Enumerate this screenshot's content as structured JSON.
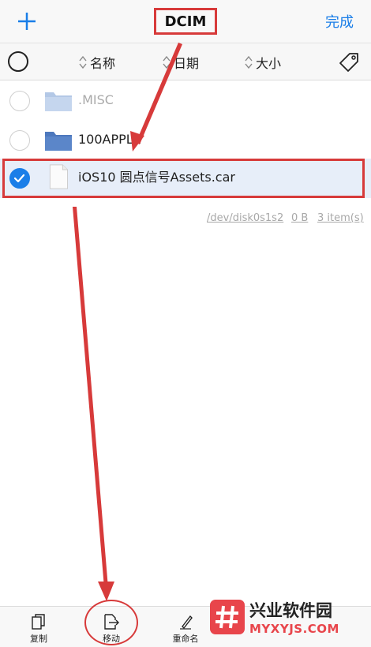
{
  "navbar": {
    "title": "DCIM",
    "done_label": "完成"
  },
  "sortbar": {
    "name_label": "名称",
    "date_label": "日期",
    "size_label": "大小"
  },
  "files": [
    {
      "name": ".MISC",
      "kind": "folder",
      "state": "dimmed"
    },
    {
      "name": "100APPLE",
      "kind": "folder",
      "state": "normal"
    },
    {
      "name": "iOS10 圆点信号Assets.car",
      "kind": "file",
      "state": "selected"
    }
  ],
  "info": {
    "device": "/dev/disk0s1s2",
    "size": "0 B",
    "count": "3 item(s)"
  },
  "toolbar": {
    "copy_label": "复制",
    "move_label": "移动",
    "rename_label": "重命名"
  },
  "watermark": {
    "title": "兴业软件园",
    "url": "MYXYJS.COM"
  },
  "colors": {
    "accent": "#1a7ee8",
    "annotation": "#d73a3a",
    "folder": "#5b86c9"
  }
}
